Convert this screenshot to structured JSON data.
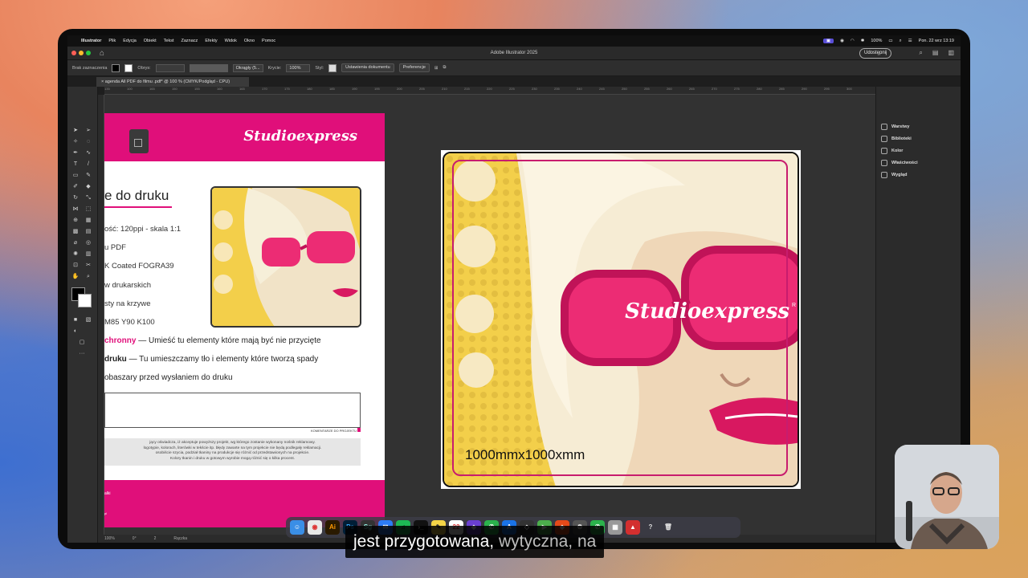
{
  "menubar": {
    "app": "Illustrator",
    "items": [
      "Plik",
      "Edycja",
      "Obiekt",
      "Tekst",
      "Zaznacz",
      "Efekty",
      "Widok",
      "Okno",
      "Pomoc"
    ],
    "battery": "100%",
    "datetime": "Pon. 22 wrz 13:19"
  },
  "window": {
    "title": "Adobe Illustrator 2025",
    "share_label": "Udostępnij"
  },
  "controlbar": {
    "selection_label": "Brak zaznaczenia",
    "stroke_label": "Obrys:",
    "brush_value": "Okrągły (5...",
    "opacity_label": "Krycie:",
    "opacity_value": "100%",
    "style_label": "Styl:",
    "doc_setup_label": "Ustawienia dokumentu",
    "prefs_label": "Preferencje"
  },
  "document": {
    "tab": "agenda All PDF do filmu .pdf* @ 100 % (CMYK/Podgląd - CPU)",
    "ruler_ticks": [
      "135",
      "100",
      "165",
      "150",
      "155",
      "160",
      "165",
      "170",
      "175",
      "180",
      "185",
      "190",
      "195",
      "200",
      "205",
      "210",
      "215",
      "220",
      "225",
      "230",
      "235",
      "240",
      "245",
      "250",
      "255",
      "260",
      "265",
      "270",
      "275",
      "280",
      "285",
      "290",
      "295",
      "300"
    ]
  },
  "left_artboard": {
    "brand": "Studioexpress",
    "title": "e do druku",
    "specs": [
      "ość: 120ppi - skala 1:1",
      "u PDF",
      "K Coated FOGRA39",
      "w drukarskich",
      "sty na krzywe",
      "M85 Y90 K100"
    ],
    "safe_zone_bold": "chronny",
    "safe_zone_text": "— Umieść tu elementy które mają być nie przycięte",
    "bleed_bold": "druku",
    "bleed_text": "— Tu umieszczamy tło i elementy które tworzą spady",
    "check_text": "obaszary przed wysłaniem do druku",
    "comment_label": "KOMENTARZE DO PROJEKTU",
    "legal_lines": [
      "jący oświadcza, iż akceptuje powyższy projekt, wg którego zostanie wykonany nośnik reklamowy.",
      "logotypie, kolorach, literówki w tekście itp. błędy zawarte na tym projekcie nie będą podlegały reklamacji.",
      "osobiście szycia, podział tkaniny na produkcje się różnić od przedstawionych na projekcie.",
      "Kolory tkanin i druku w gotowym wyrobie mogą różnić się o kilka procent."
    ],
    "band_small": "alki",
    "band_small2": "pl"
  },
  "right_artboard": {
    "dimension": "1000mmx1000xmm",
    "brand": "Studioexpress",
    "reg_mark": "R"
  },
  "panels": [
    "Warstwy",
    "Biblioteki",
    "Kolor",
    "Właściwości",
    "Wygląd"
  ],
  "statusbar": {
    "zoom": "100%",
    "rotation": "0°",
    "page": "2",
    "mode": "Rączka"
  },
  "dock": {
    "items": [
      "Finder",
      "Chrome",
      "Ai",
      "Ps",
      "Sg",
      "Mail",
      "Spotify",
      "Terminal",
      "Notes",
      "Calendar",
      "Photoshop",
      "Messages",
      "Acrobat",
      "Help",
      "Trash"
    ],
    "help_glyph": "?"
  },
  "subtitle": {
    "main": "jest przygotowana, ",
    "dim": "wytyczna, na"
  },
  "colors": {
    "brand_pink": "#e00f7a",
    "canvas_bg": "#323232",
    "art_yellow": "#f3cf4a"
  }
}
